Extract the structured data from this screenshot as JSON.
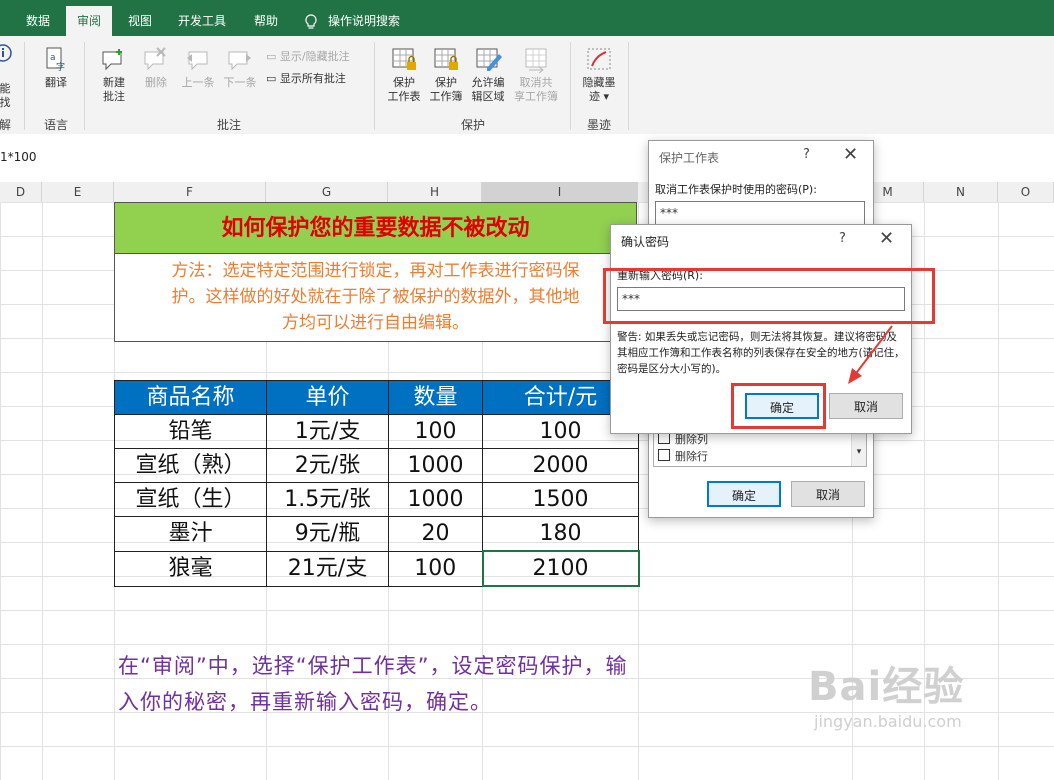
{
  "tabs": [
    {
      "label": "数据",
      "active": false
    },
    {
      "label": "审阅",
      "active": true
    },
    {
      "label": "视图",
      "active": false
    },
    {
      "label": "开发工具",
      "active": false
    },
    {
      "label": "帮助",
      "active": false
    }
  ],
  "tell_me": "操作说明搜索",
  "ribbon": {
    "partial": {
      "top": "能",
      "bottom": "找",
      "group": "解"
    },
    "translate": {
      "label": "翻译",
      "group": "语言"
    },
    "comments": {
      "new": [
        "新建",
        "批注"
      ],
      "delete": "删除",
      "prev": "上一条",
      "next": "下一条",
      "show_hide": "显示/隐藏批注",
      "show_all": "显示所有批注",
      "group": "批注"
    },
    "protect": {
      "sheet": [
        "保护",
        "工作表"
      ],
      "workbook": [
        "保护",
        "工作簿"
      ],
      "allow_edit": [
        "允许编",
        "辑区域"
      ],
      "unshare": [
        "取消共",
        "享工作簿"
      ],
      "group": "保护"
    },
    "ink": {
      "hide": [
        "隐藏墨",
        "迹 ▾"
      ],
      "group": "墨迹"
    }
  },
  "formula_bar": {
    "content": "1*100"
  },
  "columns": [
    "D",
    "E",
    "F",
    "G",
    "H",
    "I",
    "M",
    "N",
    "O"
  ],
  "sheet": {
    "title": "如何保护您的重要数据不被改动",
    "method": [
      "方法：选定特定范围进行锁定，再对工作表进行密码保",
      "护。这样做的好处就在于除了被保护的数据外，其他地",
      "方均可以进行自由编辑。"
    ],
    "headers": [
      "商品名称",
      "单价",
      "数量",
      "合计/元"
    ],
    "rows": [
      [
        "铅笔",
        "1元/支",
        "100",
        "100"
      ],
      [
        "宣纸（熟）",
        "2元/张",
        "1000",
        "2000"
      ],
      [
        "宣纸（生）",
        "1.5元/张",
        "1000",
        "1500"
      ],
      [
        "墨汁",
        "9元/瓶",
        "20",
        "180"
      ],
      [
        "狼毫",
        "21元/支",
        "100",
        "2100"
      ]
    ],
    "note": "在“审阅”中，选择“保护工作表”，设定密码保护，输入你的秘密，再重新输入密码，确定。"
  },
  "protect_dialog": {
    "title": "保护工作表",
    "help": "?",
    "close": "✕",
    "password_label": "取消工作表保护时使用的密码(P):",
    "password_value": "***",
    "options": [
      "删除列",
      "删除行"
    ],
    "ok": "确定",
    "cancel": "取消"
  },
  "confirm_dialog": {
    "title": "确认密码",
    "help": "?",
    "close": "✕",
    "reenter_label": "重新输入密码(R):",
    "password_value": "***",
    "warning": "警告: 如果丢失或忘记密码，则无法将其恢复。建议将密码及其相应工作簿和工作表名称的列表保存在安全的地方(请记住，密码是区分大小写的)。",
    "ok": "确定",
    "cancel": "取消"
  },
  "watermark": {
    "brand": "Bai经验",
    "url": "jingyan.baidu.com"
  }
}
